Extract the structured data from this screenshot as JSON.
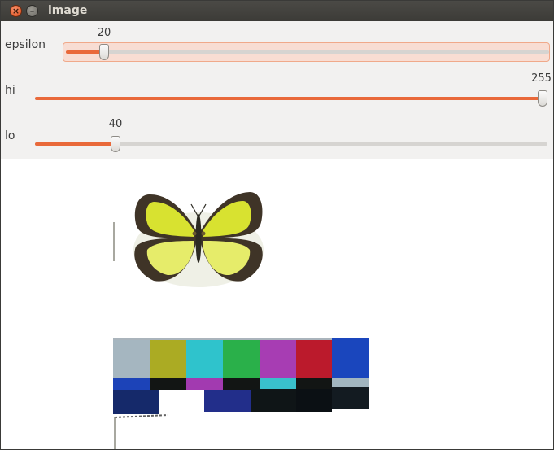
{
  "window": {
    "title": "image"
  },
  "sliders": [
    {
      "label": "epsilon",
      "value": "20",
      "fraction": 0.0784,
      "accent": "#e9693a"
    },
    {
      "label": "hi",
      "value": "255",
      "fraction": 1.0,
      "accent": "#e9693a"
    },
    {
      "label": "lo",
      "value": "40",
      "fraction": 0.1569,
      "accent": "#e9693a"
    }
  ],
  "colors": {
    "titlebar": "#3c3b37",
    "panel": "#f2f1f0",
    "slider_fill": "#e9693a",
    "chart_top_row": [
      "#a5b6c0",
      "#abab23",
      "#2fc3cc",
      "#2ab04a",
      "#a73db3",
      "#bb1a2c",
      "#1a46bd"
    ],
    "chart_mid_row": [
      "#1c43b8",
      "#121514",
      "#a23ab0",
      "#121514",
      "#39c0cc",
      "#121514",
      "#a2b6c0"
    ]
  },
  "icons": [
    "close-icon",
    "minimize-icon",
    "butterfly-image",
    "color-chart-image"
  ]
}
